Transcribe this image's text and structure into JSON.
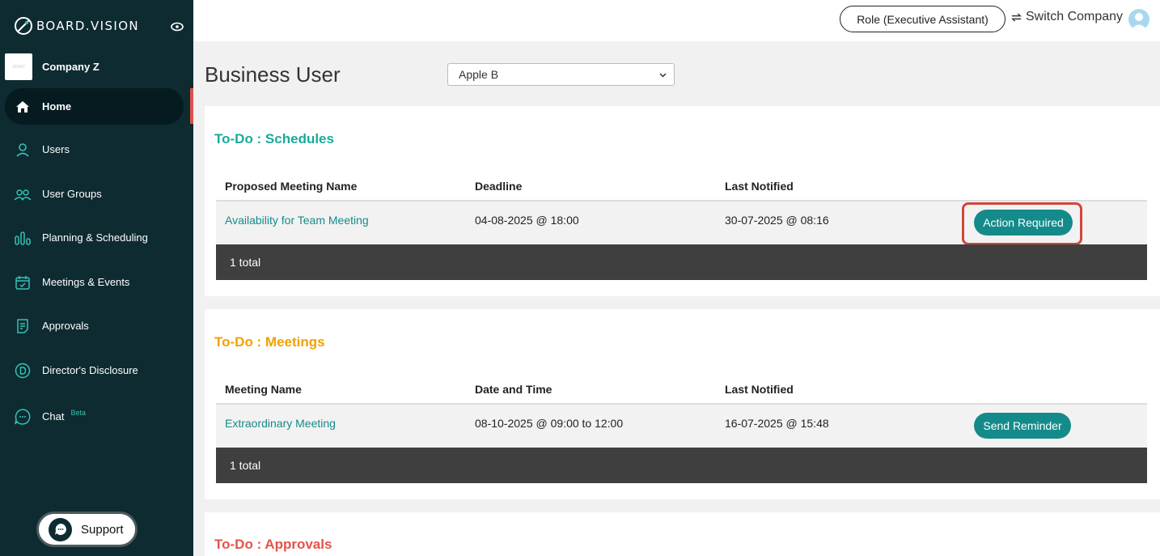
{
  "sidebar": {
    "brand": "BOARD.VISION",
    "company_name": "Company Z",
    "company_logo_text": "DEMO",
    "items": [
      {
        "label": "Home",
        "icon": "home-icon"
      },
      {
        "label": "Users",
        "icon": "user-icon"
      },
      {
        "label": "User Groups",
        "icon": "user-group-icon"
      },
      {
        "label": "Planning & Scheduling",
        "icon": "planning-icon"
      },
      {
        "label": "Meetings & Events",
        "icon": "calendar-icon"
      },
      {
        "label": "Approvals",
        "icon": "document-icon"
      },
      {
        "label": "Director's Disclosure",
        "icon": "disclosure-icon"
      },
      {
        "label": "Chat",
        "icon": "chat-icon",
        "badge": "Beta"
      }
    ],
    "support_label": "Support"
  },
  "topbar": {
    "role_label": "Role (Executive Assistant)",
    "switch_company_label": "Switch Company"
  },
  "main": {
    "title": "Business User",
    "company_select": "Apple B",
    "schedules": {
      "title": "To-Do : Schedules",
      "title_color": "#1aaa9b",
      "columns": [
        "Proposed Meeting Name",
        "Deadline",
        "Last Notified"
      ],
      "rows": [
        {
          "name": "Availability for Team Meeting",
          "deadline": "04-08-2025 @ 18:00",
          "last_notified": "30-07-2025 @ 08:16",
          "action": "Action Required"
        }
      ],
      "total": "1 total"
    },
    "meetings": {
      "title": "To-Do : Meetings",
      "title_color": "#f2a100",
      "columns": [
        "Meeting Name",
        "Date and Time",
        "Last Notified"
      ],
      "rows": [
        {
          "name": "Extraordinary Meeting",
          "date_time": "08-10-2025 @ 09:00 to 12:00",
          "last_notified": "16-07-2025 @ 15:48",
          "action": "Send Reminder"
        }
      ],
      "total": "1 total"
    },
    "approvals": {
      "title": "To-Do : Approvals",
      "title_color": "#e6524a"
    }
  },
  "colors": {
    "sidebar_bg": "#0e2b32",
    "accent": "#148b8a",
    "highlight": "#d0473b"
  }
}
